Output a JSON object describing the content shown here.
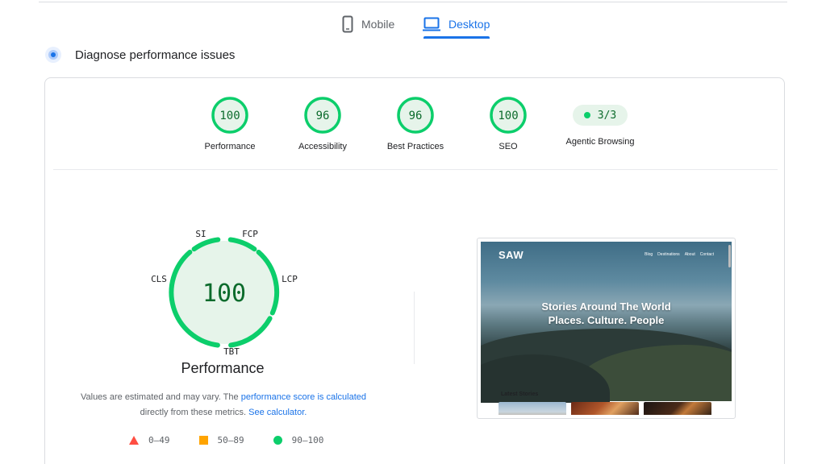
{
  "tabs": [
    {
      "label": "Mobile",
      "icon": "phone-icon",
      "active": false
    },
    {
      "label": "Desktop",
      "icon": "laptop-icon",
      "active": true
    }
  ],
  "section": {
    "title": "Diagnose performance issues",
    "icon": "sparkle-icon"
  },
  "scores": [
    {
      "label": "Performance",
      "score": "100"
    },
    {
      "label": "Accessibility",
      "score": "96"
    },
    {
      "label": "Best Practices",
      "score": "96"
    },
    {
      "label": "SEO",
      "score": "100"
    }
  ],
  "agentic": {
    "label": "Agentic Browsing",
    "value": "3/3"
  },
  "performance_gauge": {
    "score": "100",
    "label": "Performance",
    "metrics": [
      "SI",
      "FCP",
      "LCP",
      "TBT",
      "CLS"
    ]
  },
  "note": {
    "text_before": "Values are estimated and may vary. The ",
    "link1": "performance score is calculated",
    "text_middle": "directly from these metrics. ",
    "link2": "See calculator."
  },
  "legend": [
    {
      "shape": "triangle",
      "range": "0–49",
      "color": "#ff4e42"
    },
    {
      "shape": "square",
      "range": "50–89",
      "color": "#ffa400"
    },
    {
      "shape": "circle",
      "range": "90–100",
      "color": "#0cce6b"
    }
  ],
  "screenshot": {
    "logo": "SAW",
    "nav": [
      "Blog",
      "Destinations",
      "About",
      "Contact"
    ],
    "hero_line1": "Stories Around The World",
    "hero_line2": "Places. Culture. People",
    "section_title": "Latest Stories"
  },
  "colors": {
    "pass": "#0cce6b",
    "pass_fill": "#e6f4ea",
    "pass_text": "#0c6b2c",
    "accent": "#1a73e8"
  }
}
